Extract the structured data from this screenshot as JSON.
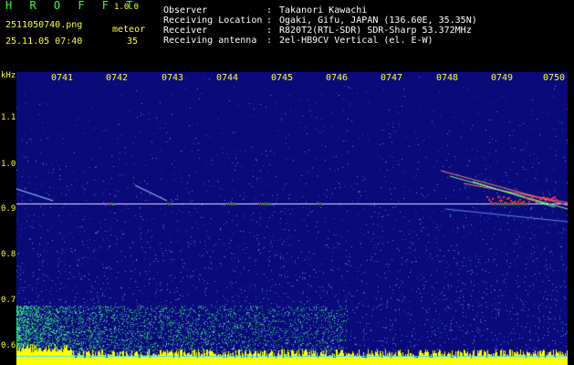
{
  "header": {
    "app_name": "H R O F F T",
    "version": "1.0.0",
    "filename": "2511050740.png",
    "datetime": "25.11.05 07:40",
    "count_label": "meteor",
    "count_value": "35",
    "info": [
      {
        "key": "Observer",
        "sep": ":",
        "value": "Takanori Kawachi"
      },
      {
        "key": "Receiving Location",
        "sep": ":",
        "value": "Ogaki, Gifu, JAPAN (136.60E, 35.35N)"
      },
      {
        "key": "Receiver",
        "sep": ":",
        "value": "R820T2(RTL-SDR) SDR-Sharp 53.372MHz"
      },
      {
        "key": "Receiving antenna",
        "sep": ":",
        "value": "2el-HB9CV Vertical (el. E-W)"
      }
    ]
  },
  "spectrogram": {
    "y_unit": "kHz",
    "y_ticks": [
      "1.1",
      "1.0",
      "0.9",
      "0.8",
      "0.7",
      "0.6"
    ],
    "x_ticks": [
      "0741",
      "0742",
      "0743",
      "0744",
      "0745",
      "0746",
      "0747",
      "0748",
      "0749",
      "0750"
    ],
    "colors": {
      "background": "#0a0a7a",
      "noise": "#3a6cff",
      "carrier": "#e0e0ff",
      "echo": "#ff3030",
      "baseline": "#ffff00",
      "ground_noise": "#20c060"
    }
  }
}
